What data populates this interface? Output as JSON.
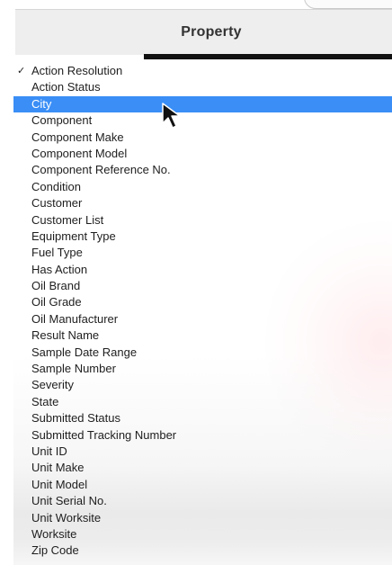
{
  "header": {
    "title": "Property"
  },
  "menu": {
    "check_mark": "✓",
    "selected_index": 2,
    "items": [
      "Action Resolution",
      "Action Status",
      "City",
      "Component",
      "Component Make",
      "Component Model",
      "Component Reference No.",
      "Condition",
      "Customer",
      "Customer List",
      "Equipment Type",
      "Fuel Type",
      "Has Action",
      "Oil Brand",
      "Oil Grade",
      "Oil Manufacturer",
      "Result Name",
      "Sample Date Range",
      "Sample Number",
      "Severity",
      "State",
      "Submitted Status",
      "Submitted Tracking Number",
      "Unit ID",
      "Unit Make",
      "Unit Model",
      "Unit Serial No.",
      "Unit Worksite",
      "Worksite",
      "Zip Code"
    ]
  },
  "colors": {
    "selection": "#3a8ef6",
    "header_bg": "#eeeeee",
    "header_underline": "#111111",
    "text": "#1e1e1e"
  },
  "icons": {
    "checked_item": "check-icon",
    "pointer": "mouse-pointer-icon"
  }
}
